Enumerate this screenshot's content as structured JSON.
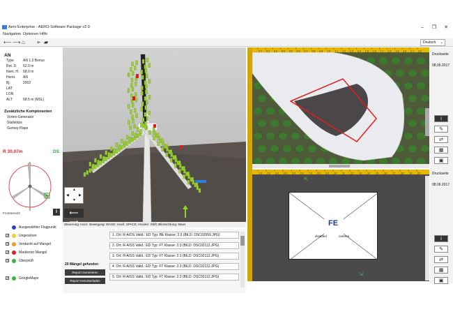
{
  "window": {
    "title": "Aero Enterprise - AERO-Software Package v2.9",
    "minimize": "–",
    "maximize": "❐",
    "close": "✕"
  },
  "menu": [
    "Navigation",
    "Optionen",
    "Hilfe"
  ],
  "toolbar_icons": [
    "arrow-left-icon",
    "arrow-right-icon",
    "home-icon",
    "send-icon",
    "folder-icon"
  ],
  "language": "Deutsch",
  "turbine": {
    "name": "AN",
    "fields": [
      {
        "label": "Type",
        "value": "AN 1.3 Bonus"
      },
      {
        "label": "Rot. D.",
        "value": "62.0 m"
      },
      {
        "label": "Nom. H.",
        "value": "68.0 m"
      },
      {
        "label": "Herst.",
        "value": "AN"
      },
      {
        "label": "Bj.",
        "value": "2002"
      },
      {
        "label": "LAT",
        "value": ""
      },
      {
        "label": "LON",
        "value": ""
      },
      {
        "label": "ALT",
        "value": "68.5 m (MSL)"
      }
    ]
  },
  "components": {
    "title": "Zusätzliche Komponenten",
    "items": [
      "Vortex-Generator",
      "Stallstrips",
      "Gurney-Flaps"
    ]
  },
  "frontview": {
    "radius": "R 30.07m",
    "side": "DS",
    "label": "Frontansicht"
  },
  "legend": [
    {
      "label": "Ausgewählter Flugpunkt",
      "color": "#2a3fd0",
      "checkbox": false
    },
    {
      "label": "Ungesehen",
      "color": "#f2d21c",
      "checkbox": true
    },
    {
      "label": "Verdacht auf Mangel",
      "color": "#f39a1a",
      "checkbox": true
    },
    {
      "label": "Markierter Mangel",
      "color": "#d81f1f",
      "checkbox": true
    },
    {
      "label": "Überprüft",
      "color": "#39b339",
      "checkbox": true
    },
    {
      "label": "GoogleMaps",
      "color": "#39b339",
      "checkbox": true
    }
  ],
  "viewport_status": "Steuerung: Horiz. Bewegung: WASD; Hoch: SPACE; Hrunter: Shift; Blickrichtung: Maus",
  "defects": {
    "count_label": "20 Mängel gefunden",
    "generate": "Report Generieren",
    "download": "Report Herunterladen",
    "rows": [
      "1. Ort: R-A/DS  Valid.: ED  Typ: BE  Klasse: 2:3  (BILD: DSC02059.JPG)",
      "2. Ort: R-A/SS  Valid.: ED  Typ: FT  Klasse: 2:3  (BILD: DSC02112.JPG)",
      "3. Ort: R-A/SS  Valid.: ED  Typ: FT  Klasse: 2:3  (BILD: DSC02112.JPG)",
      "4. Ort: R-A/SS  Valid.: ED  Typ: FT  Klasse: 2:3  (BILD: DSC02112.JPG)",
      "5. Ort: R-A/SS  Valid.: ED  Typ: FT  Klasse: 2:3  (BILD: DSC02112.JPG)"
    ]
  },
  "ruler_ticks_top": [
    "0.1",
    "0.2",
    "0.3",
    "0.4",
    "0.5",
    "0.6",
    "0.7",
    "0.8",
    "0.9",
    "1.0",
    "1.1",
    "1.2",
    "1.3",
    "1.4",
    "1.5",
    "1.6",
    "1.7",
    "1.8",
    "1.9",
    "2.0",
    "2.1",
    "2.2"
  ],
  "ruler_ticks_bottom": [
    "1.0",
    "2.0",
    "3.0",
    "4.0",
    "5.0",
    "6.0",
    "7.0",
    "8.0",
    "9.0",
    "10",
    "11",
    "12",
    "13",
    "14",
    "15",
    "16",
    "17",
    "18",
    "19",
    "20"
  ],
  "right_panel": {
    "print_label": "Druckseite",
    "date": "08.06.2017",
    "buttons": [
      "info-icon",
      "edit-icon",
      "swap-icon",
      "grid-icon",
      "image-icon"
    ]
  },
  "camera": {
    "logo": "FE",
    "disabled": "disabled",
    "camera": "camera"
  },
  "colors": {
    "ruler": "#e8b800",
    "defect_outline": "#e02020",
    "blade_point": "#9acd32"
  }
}
